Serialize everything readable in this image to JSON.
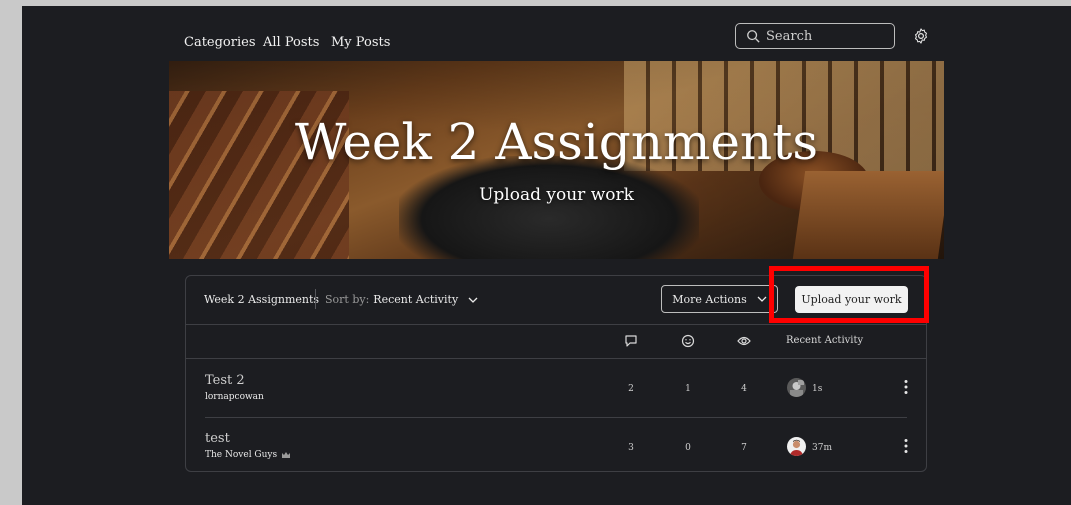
{
  "nav": {
    "links": [
      "Categories",
      "All Posts",
      "My Posts"
    ],
    "search_placeholder": "Search"
  },
  "banner": {
    "title": "Week 2 Assignments",
    "subtitle": "Upload your work"
  },
  "toolbar": {
    "board_name": "Week 2 Assignments",
    "sort_prefix": "Sort by:",
    "sort_value": "Recent Activity",
    "more_actions": "More Actions",
    "upload_button": "Upload your work"
  },
  "table": {
    "columns": {
      "comments_icon": "comment-icon",
      "likes_icon": "smiley-icon",
      "views_icon": "eye-icon",
      "recent_activity": "Recent Activity"
    },
    "rows": [
      {
        "title": "Test 2",
        "author": "lornapcowan",
        "comments": "2",
        "likes": "1",
        "views": "4",
        "time": "1s",
        "author_badge": false
      },
      {
        "title": "test",
        "author": "The Novel Guys",
        "comments": "3",
        "likes": "0",
        "views": "7",
        "time": "37m",
        "author_badge": true
      }
    ]
  },
  "colors": {
    "background": "#1c1d21",
    "border": "#3e3f44",
    "highlight": "#ff0000",
    "primary_button": "#f2f2f2"
  }
}
